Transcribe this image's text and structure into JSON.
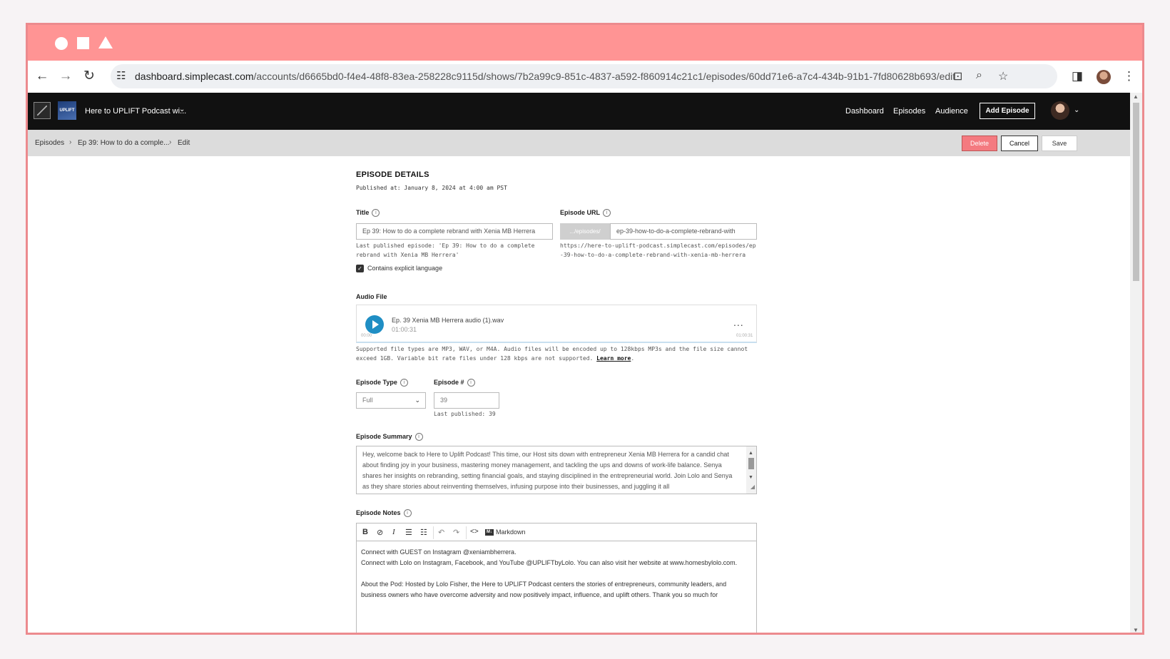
{
  "browser": {
    "url_host": "dashboard.simplecast.com",
    "url_path": "/accounts/d6665bd0-f4e4-48f8-83ea-258228c9115d/shows/7b2a99c9-851c-4837-a592-f860914c21c1/episodes/60dd71e6-a7c4-434b-91b1-7fd80628b693/edit"
  },
  "app_header": {
    "show_thumb_text": "UPLIFT",
    "show_name": "Here to UPLIFT Podcast wi...",
    "nav": [
      "Dashboard",
      "Episodes",
      "Audience"
    ],
    "add_episode": "Add Episode"
  },
  "breadcrumb": {
    "items": [
      "Episodes",
      "Ep 39: How to do a comple...",
      "Edit"
    ],
    "separator": "›"
  },
  "actions": {
    "delete": "Delete",
    "cancel": "Cancel",
    "save": "Save"
  },
  "details": {
    "section_title": "EPISODE DETAILS",
    "published": "Published at: January 8, 2024 at 4:00 am PST",
    "title_label": "Title",
    "title_value": "Ep 39: How to do a complete rebrand with Xenia MB Herrera",
    "title_hint": "Last published episode: 'Ep 39: How to do a complete rebrand with Xenia MB Herrera'",
    "url_label": "Episode URL",
    "url_prefix": ".../episodes/",
    "url_slug": "ep-39-how-to-do-a-complete-rebrand-with",
    "url_hint": "https://here-to-uplift-podcast.simplecast.com/episodes/ep-39-how-to-do-a-complete-rebrand-with-xenia-mb-herrera",
    "explicit_label": "Contains explicit language",
    "explicit_checked": true
  },
  "audio": {
    "label": "Audio File",
    "file_name": "Ep. 39 Xenia MB Herrera audio (1).wav",
    "duration": "01:00:31",
    "time_start": "00:00",
    "time_end": "01:00:31",
    "more": "...",
    "note": "Supported file types are MP3, WAV, or M4A. Audio files will be encoded up to 128kbps MP3s and the file size cannot exceed 1GB. Variable bit rate files under 128 kbps are not supported.",
    "learn_more": "Learn more"
  },
  "episode_type": {
    "label": "Episode Type",
    "value": "Full"
  },
  "episode_number": {
    "label": "Episode #",
    "value": "39",
    "hint": "Last published: 39"
  },
  "summary": {
    "label": "Episode Summary",
    "text": "Hey, welcome back to Here to Uplift Podcast! This time, our Host sits down with entrepreneur Xenia MB Herrera for a candid chat about finding joy in your business, mastering money management, and tackling the ups and downs of work-life balance. Senya shares her insights on rebranding, setting financial goals, and staying disciplined in the entrepreneurial world. Join Lolo and Senya as they share stories about reinventing themselves, infusing purpose into their businesses, and juggling it all"
  },
  "notes": {
    "label": "Episode Notes",
    "markdown_badge": "M↓",
    "markdown_label": "Markdown",
    "lines": [
      "Connect with GUEST on Instagram @xeniambherrera.",
      "Connect with Lolo on Instagram, Facebook, and YouTube @UPLIFTbyLolo. You can also visit her website at www.homesbylolo.com.",
      "",
      "About the Pod: Hosted by Lolo Fisher, the Here to UPLIFT Podcast centers the stories of entrepreneurs, community leaders, and business owners who have overcome adversity and now positively impact, influence, and uplift others. Thank you so much for"
    ]
  },
  "colors": {
    "window_bar": "#ff9494",
    "delete": "#f47a80",
    "play": "#1f8ec4",
    "header": "#111111"
  }
}
